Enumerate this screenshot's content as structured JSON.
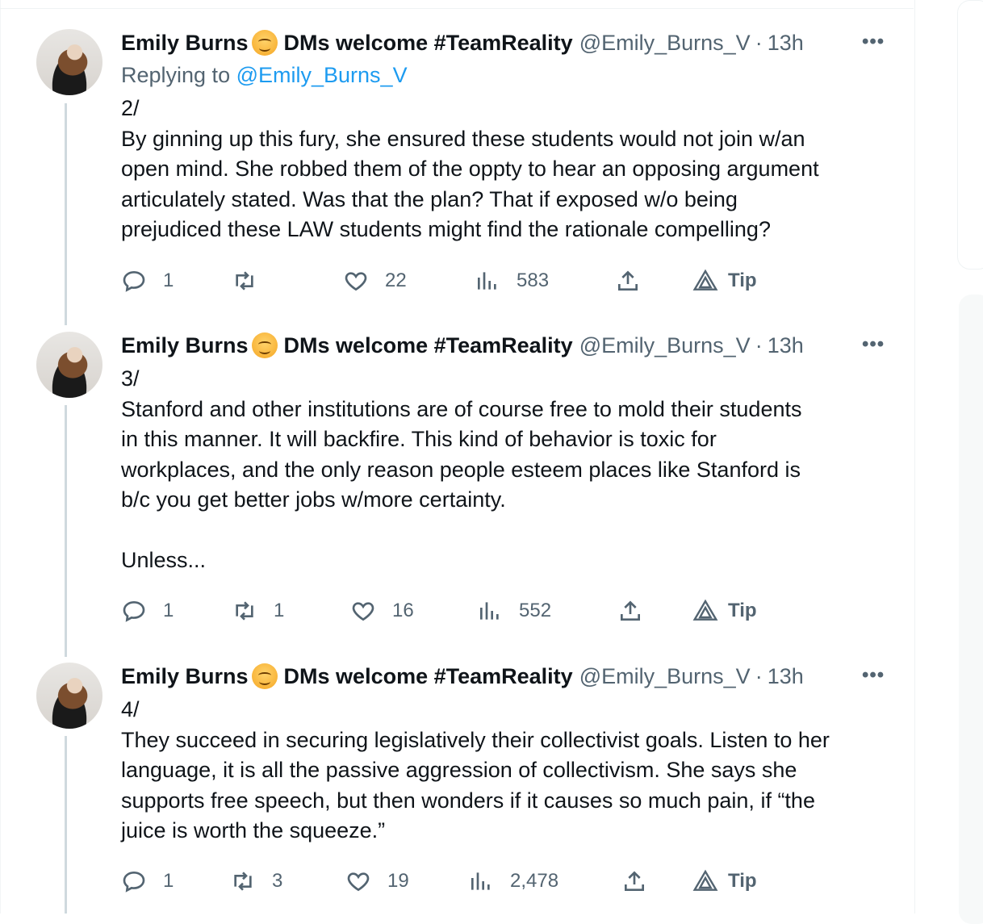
{
  "author": {
    "name": "Emily Burns",
    "emoji": "smiling-face-icon",
    "display_suffix": "DMs welcome #TeamReality",
    "handle": "@Emily_Burns_V",
    "separator": "·"
  },
  "icons": {
    "more": "more-icon",
    "reply": "reply-icon",
    "retweet": "retweet-icon",
    "like": "heart-icon",
    "views": "views-icon",
    "share": "share-icon",
    "tip": "tip-icon"
  },
  "colors": {
    "accent": "#1d9bf0",
    "muted": "#536471",
    "text": "#0f1419"
  },
  "tweets": [
    {
      "time": "13h",
      "replying_prefix": "Replying to ",
      "replying_handle": "@Emily_Burns_V",
      "paragraphs": [
        "2/",
        "By ginning up this fury, she ensured these students would not join w/an",
        "open mind. She robbed them of the oppty to hear an opposing argument",
        "articulately stated. Was that the plan? That if exposed w/o being",
        "prejudiced these LAW students might find the rationale compelling?"
      ],
      "replies": "1",
      "retweets": "",
      "likes": "22",
      "views": "583",
      "tip_label": "Tip"
    },
    {
      "time": "13h",
      "paragraphs": [
        "3/",
        "Stanford and other institutions are of course free to mold their students",
        "in this manner. It will backfire. This kind of behavior is toxic for",
        "workplaces, and the only reason people esteem places like Stanford is",
        "b/c you get better jobs w/more certainty.",
        "",
        "Unless..."
      ],
      "replies": "1",
      "retweets": "1",
      "likes": "16",
      "views": "552",
      "tip_label": "Tip"
    },
    {
      "time": "13h",
      "paragraphs": [
        "4/",
        "They succeed in securing legislatively their collectivist goals. Listen to her",
        "language, it is all the passive aggression of collectivism. She says she",
        "supports free speech, but then wonders if it causes so much pain, if “the",
        "juice is worth the squeeze.”"
      ],
      "replies": "1",
      "retweets": "3",
      "likes": "19",
      "views": "2,478",
      "tip_label": "Tip"
    }
  ]
}
